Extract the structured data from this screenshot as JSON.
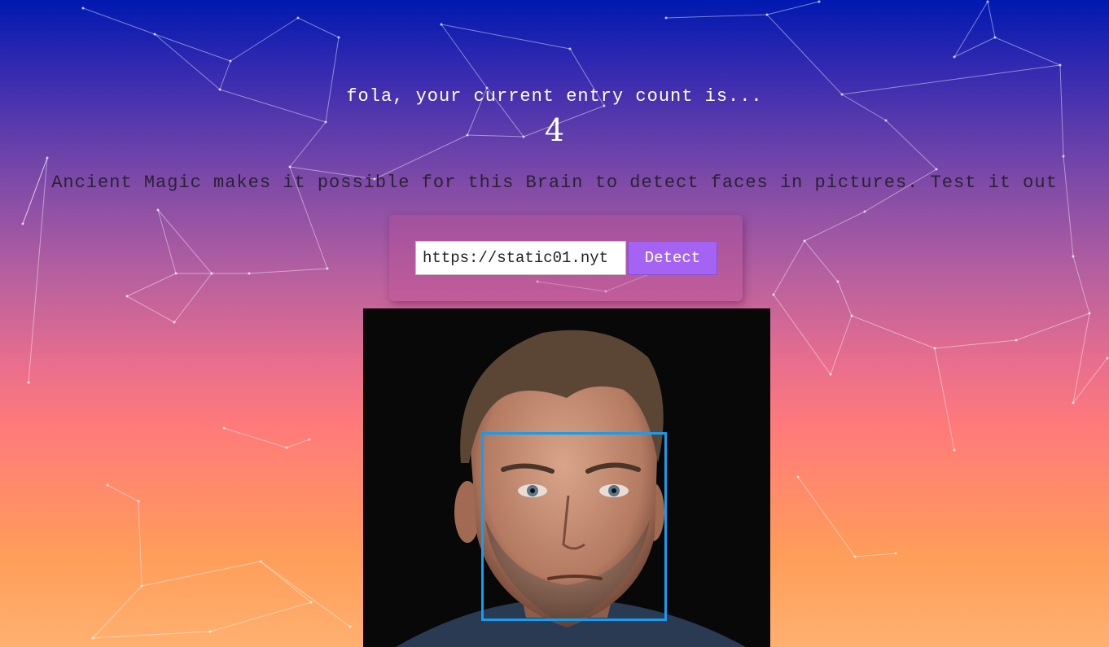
{
  "header": {
    "greeting": "fola, your current entry count is...",
    "entry_count": "4"
  },
  "tagline": "Ancient Magic makes it possible for this Brain to detect faces in pictures. Test it out",
  "form": {
    "url_value": "https://static01.nyt",
    "detect_label": "Detect"
  },
  "result": {
    "image_description_icon": "portrait-photo",
    "box_color": "#149df2",
    "faces_detected": 1
  },
  "colors": {
    "button": "#a463f2",
    "gradient_top": "#0019b0",
    "gradient_bottom": "#ffb070"
  }
}
